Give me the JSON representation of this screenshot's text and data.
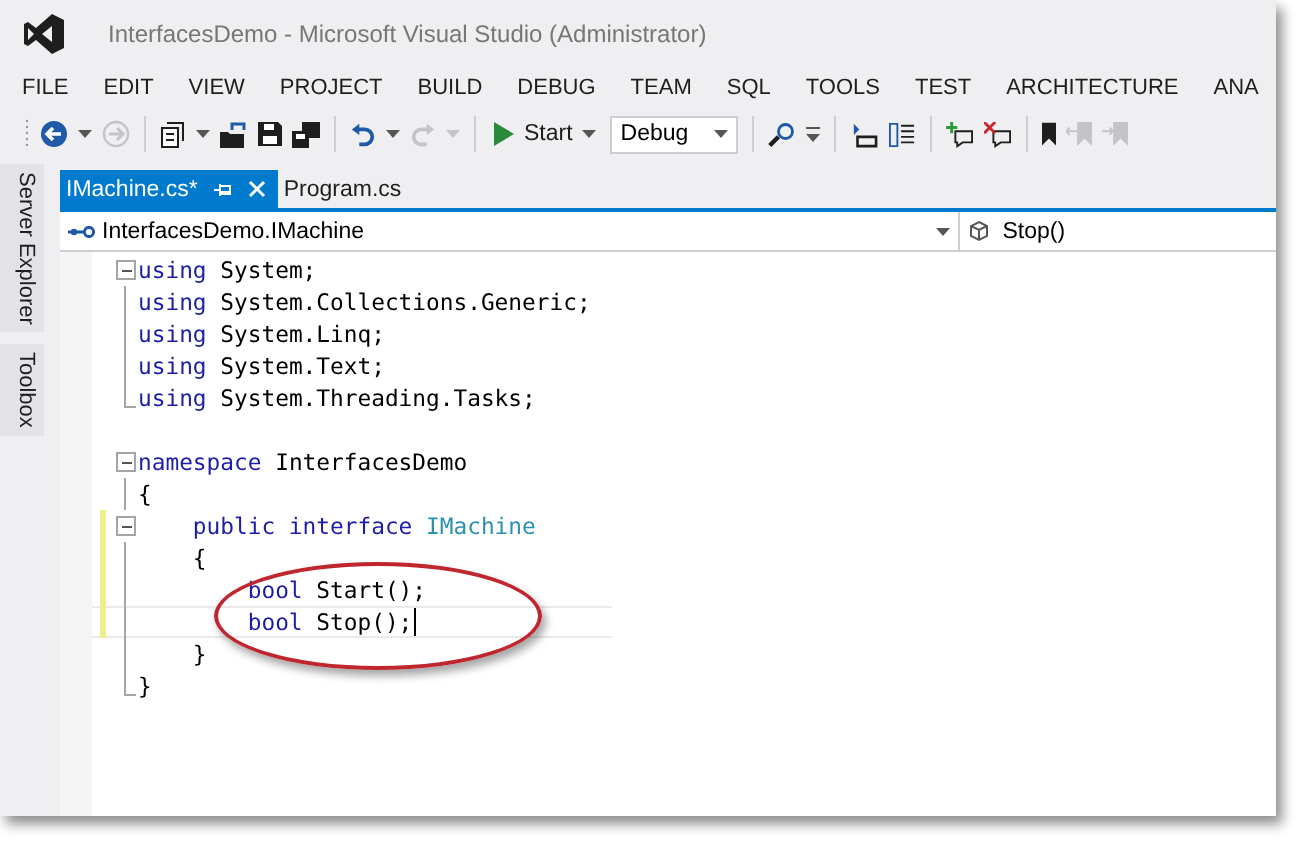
{
  "window": {
    "title": "InterfacesDemo - Microsoft Visual Studio (Administrator)"
  },
  "menu": [
    "FILE",
    "EDIT",
    "VIEW",
    "PROJECT",
    "BUILD",
    "DEBUG",
    "TEAM",
    "SQL",
    "TOOLS",
    "TEST",
    "ARCHITECTURE",
    "ANA"
  ],
  "toolbar": [
    {
      "kind": "back",
      "disabled": false
    },
    {
      "kind": "caret",
      "disabled": false
    },
    {
      "kind": "forward",
      "disabled": true
    },
    {
      "kind": "separator"
    },
    {
      "kind": "new-project",
      "disabled": false
    },
    {
      "kind": "caret",
      "disabled": false
    },
    {
      "kind": "open",
      "disabled": false
    },
    {
      "kind": "save",
      "disabled": false
    },
    {
      "kind": "save-all",
      "disabled": false
    },
    {
      "kind": "separator"
    },
    {
      "kind": "undo",
      "disabled": false
    },
    {
      "kind": "caret",
      "disabled": false
    },
    {
      "kind": "redo",
      "disabled": true
    },
    {
      "kind": "caret",
      "disabled": true
    },
    {
      "kind": "separator"
    },
    {
      "kind": "start",
      "label": "Start"
    },
    {
      "kind": "select",
      "label": "Debug"
    },
    {
      "kind": "separator"
    },
    {
      "kind": "find",
      "disabled": false
    },
    {
      "kind": "overflow",
      "disabled": false
    },
    {
      "kind": "separator"
    },
    {
      "kind": "indent",
      "disabled": false
    },
    {
      "kind": "outline",
      "disabled": false
    },
    {
      "kind": "separator"
    },
    {
      "kind": "comment-add",
      "disabled": false
    },
    {
      "kind": "comment-remove",
      "disabled": false
    },
    {
      "kind": "separator"
    },
    {
      "kind": "bookmark",
      "disabled": false
    },
    {
      "kind": "bookmark-prev",
      "disabled": true
    },
    {
      "kind": "bookmark-next",
      "disabled": true
    }
  ],
  "side_tabs": [
    "Server Explorer",
    "Toolbox"
  ],
  "tabs": [
    {
      "label": "IMachine.cs*",
      "selected": true
    },
    {
      "label": "Program.cs",
      "selected": false
    }
  ],
  "nav_bar": {
    "type_selector": "InterfacesDemo.IMachine",
    "member_selector": "Stop()"
  },
  "code_lines": [
    {
      "kind": "fold-start",
      "changed": false,
      "tokens": [
        {
          "kind": "keyword",
          "text": "using"
        },
        {
          "kind": "plain",
          "text": " System;"
        }
      ]
    },
    {
      "kind": "fold-inner",
      "changed": false,
      "tokens": [
        {
          "kind": "keyword",
          "text": "using"
        },
        {
          "kind": "plain",
          "text": " System.Collections.Generic;"
        }
      ]
    },
    {
      "kind": "fold-inner",
      "changed": false,
      "tokens": [
        {
          "kind": "keyword",
          "text": "using"
        },
        {
          "kind": "plain",
          "text": " System.Linq;"
        }
      ]
    },
    {
      "kind": "fold-inner",
      "changed": false,
      "tokens": [
        {
          "kind": "keyword",
          "text": "using"
        },
        {
          "kind": "plain",
          "text": " System.Text;"
        }
      ]
    },
    {
      "kind": "fold-end",
      "changed": false,
      "tokens": [
        {
          "kind": "keyword",
          "text": "using"
        },
        {
          "kind": "plain",
          "text": " System.Threading.Tasks;"
        }
      ]
    },
    {
      "kind": "blank",
      "changed": false
    },
    {
      "kind": "fold-start",
      "changed": false,
      "tokens": [
        {
          "kind": "keyword",
          "text": "namespace"
        },
        {
          "kind": "plain",
          "text": " InterfacesDemo"
        }
      ]
    },
    {
      "kind": "fold-inner",
      "changed": false,
      "tokens": [
        {
          "kind": "plain",
          "text": "{"
        }
      ]
    },
    {
      "kind": "fold-start",
      "changed": true,
      "tokens": [
        {
          "kind": "keyword",
          "text": "    public"
        },
        {
          "kind": "keyword",
          "text": " interface"
        },
        {
          "kind": "type",
          "text": " IMachine"
        }
      ]
    },
    {
      "kind": "fold-inner",
      "changed": true,
      "tokens": [
        {
          "kind": "plain",
          "text": "    {"
        }
      ]
    },
    {
      "kind": "fold-inner",
      "changed": true,
      "tokens": [
        {
          "kind": "keyword",
          "text": "        bool"
        },
        {
          "kind": "plain",
          "text": " Start();"
        }
      ]
    },
    {
      "kind": "fold-inner",
      "changed": true,
      "caret": true,
      "current": true,
      "tokens": [
        {
          "kind": "keyword",
          "text": "        bool"
        },
        {
          "kind": "plain",
          "text": " Stop();"
        }
      ]
    },
    {
      "kind": "fold-inner",
      "changed": false,
      "tokens": [
        {
          "kind": "plain",
          "text": "    }"
        }
      ]
    },
    {
      "kind": "fold-end",
      "changed": false,
      "tokens": [
        {
          "kind": "plain",
          "text": "}"
        }
      ]
    }
  ],
  "annotations": [
    {
      "kind": "ellipse"
    }
  ]
}
